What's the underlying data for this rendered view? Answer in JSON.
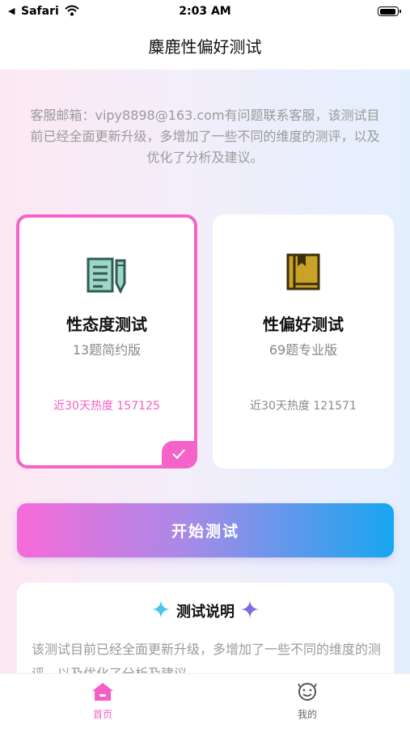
{
  "status_bar": {
    "back_glyph": "◀",
    "carrier": "Safari",
    "time": "2:03 AM"
  },
  "nav": {
    "title": "麋鹿性偏好测试"
  },
  "notice": "客服邮箱：vipy8898@163.com有问题联系客服，该测试目前已经全面更新升级，多增加了一些不同的维度的测评，以及优化了分析及建议。",
  "cards": [
    {
      "title": "性态度测试",
      "subtitle": "13题简约版",
      "heat": "近30天热度 157125",
      "icon": "notebook-pen-icon",
      "selected": true
    },
    {
      "title": "性偏好测试",
      "subtitle": "69题专业版",
      "heat": "近30天热度 121571",
      "icon": "book-icon",
      "selected": false
    }
  ],
  "start_button": "开始测试",
  "description": {
    "title": "测试说明",
    "text": "该测试目前已经全面更新升级，多增加了一些不同的维度的测评，以及优化了分析及建议。"
  },
  "tabbar": [
    {
      "label": "首页",
      "icon": "home-icon",
      "active": true
    },
    {
      "label": "我的",
      "icon": "smiley-icon",
      "active": false
    }
  ],
  "colors": {
    "accent_pink": "#f563c9",
    "accent_blue": "#18a6f0",
    "icon_green": "#2f5d52",
    "icon_gold": "#c9a227"
  }
}
